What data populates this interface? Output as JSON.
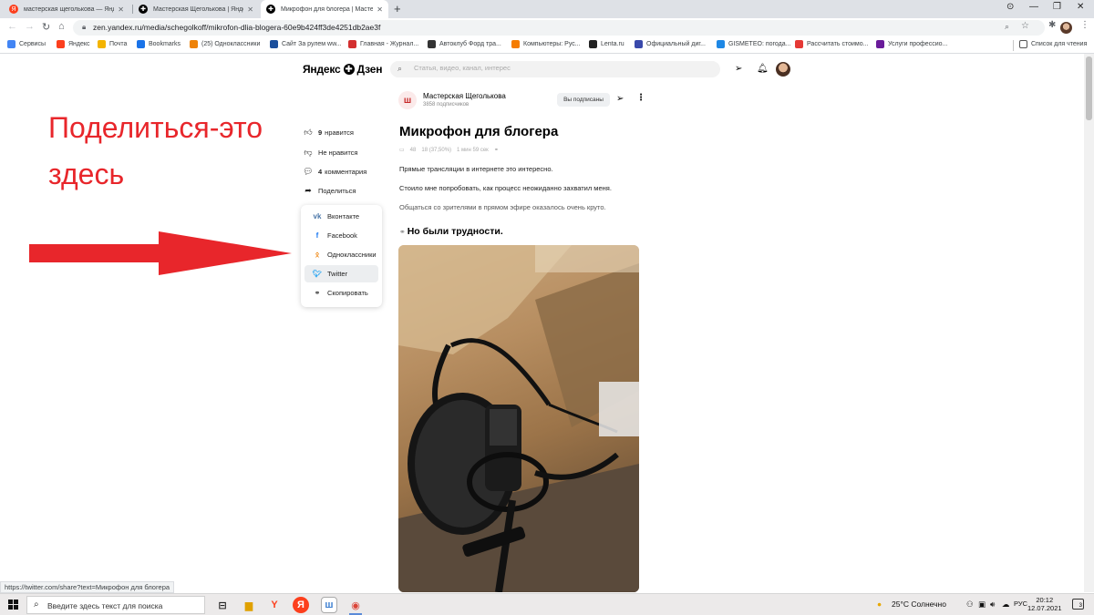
{
  "browser": {
    "tabs": [
      {
        "title": "мастерская щеголькова — Янде",
        "favicon": "yandex-icon"
      },
      {
        "title": "Мастерская Щеголькова | Янде",
        "favicon": "zen-icon"
      },
      {
        "title": "Микрофон для блогера | Масте",
        "favicon": "zen-icon",
        "active": true
      }
    ],
    "url": "zen.yandex.ru/media/schegolkoff/mikrofon-dlia-blogera-60e9b424ff3de4251db2ae3f",
    "bookmarks": [
      {
        "label": "Сервисы",
        "color": "#4285f4"
      },
      {
        "label": "Яндекс",
        "color": "#fc3f1d"
      },
      {
        "label": "Почта",
        "color": "#f4b400"
      },
      {
        "label": "Bookmarks",
        "color": "#1a73e8"
      },
      {
        "label": "(25) Одноклассники",
        "color": "#ee8208"
      },
      {
        "label": "Сайт За рулем ww...",
        "color": "#1b4f9c"
      },
      {
        "label": "Главная - Журнал...",
        "color": "#d32f2f"
      },
      {
        "label": "Автоклуб Форд тра...",
        "color": "#333333"
      },
      {
        "label": "Компьютеры: Рус...",
        "color": "#f57c00"
      },
      {
        "label": "Lenta.ru",
        "color": "#222222"
      },
      {
        "label": "Официальный диг...",
        "color": "#3949ab"
      },
      {
        "label": "GISMETEO: погода...",
        "color": "#1e88e5"
      },
      {
        "label": "Рассчитать стоимо...",
        "color": "#e53935"
      },
      {
        "label": "Услуги профессио...",
        "color": "#6a1b9a"
      }
    ],
    "reading_list": "Список для чтения",
    "status_url": "https://twitter.com/share?text=Микрофон для блогера"
  },
  "header": {
    "logo_left": "Яндекс",
    "logo_right": "Дзен",
    "search_placeholder": "Статья, видео, канал, интерес"
  },
  "channel": {
    "name": "Мастерская Щеголькова",
    "subscribers": "3858 подписчиков",
    "subscribe_label": "Вы подписаны"
  },
  "article": {
    "title": "Микрофон для блогера",
    "meta_views": "48",
    "meta_read": "18 (37,50%)",
    "meta_time": "1 мин 59 сек",
    "paragraphs": [
      "Прямые трансляции в интернете это интересно.",
      "Стоило мне попробовать, как процесс неожиданно захватил меня.",
      "Общаться со зрителями в прямом эфире оказалось очень круто."
    ],
    "subheading": "Но были трудности."
  },
  "reactions": {
    "like_count": "9",
    "like_label": "нравится",
    "dislike_label": "Не нравится",
    "comments_count": "4",
    "comments_label": "комментария",
    "share_label": "Поделиться"
  },
  "share_menu": [
    {
      "label": "Вконтакте",
      "icon": "vk-icon",
      "color": "#4a76a8"
    },
    {
      "label": "Facebook",
      "icon": "facebook-icon",
      "color": "#1877f2"
    },
    {
      "label": "Одноклассники",
      "icon": "odnoklassniki-icon",
      "color": "#ee8208"
    },
    {
      "label": "Twitter",
      "icon": "twitter-icon",
      "color": "#1da1f2"
    },
    {
      "label": "Скопировать",
      "icon": "link-icon",
      "color": "#333333"
    }
  ],
  "annotation": {
    "line1": "Поделиться-это",
    "line2": "здесь",
    "color": "#e8262b"
  },
  "taskbar": {
    "search_text": "Введите здесь текст для поиска",
    "weather": "25°C  Солнечно",
    "language": "РУС",
    "time": "20:12",
    "date": "12.07.2021",
    "notifications": "3"
  }
}
